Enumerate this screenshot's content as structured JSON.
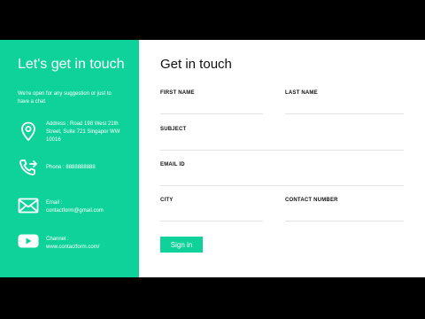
{
  "left": {
    "title": "Let's get in touch",
    "subtitle": "We're open for any suggestion or just to have a chat",
    "address": "Address : Road 198 West 21th Street, Suite 721 Singapor WW 10016",
    "phone": "Phone : 8888888888",
    "email_label": "Email :",
    "email_value": "contactform@gmail.com",
    "channel_label": "Channel :",
    "channel_value": "www.contactform.com/"
  },
  "form": {
    "title": "Get in touch",
    "first_name": "FIRST NAME",
    "last_name": "LAST NAME",
    "subject": "SUBJECT",
    "email_id": "EMAIL ID",
    "city": "CITY",
    "contact_number": "CONTACT NUMBER",
    "submit": "Sign in"
  },
  "colors": {
    "accent": "#0fd29a",
    "background": "#000000",
    "card": "#ffffff",
    "text": "#111111"
  },
  "icons": {
    "address": "map-pin-icon",
    "phone": "phone-forward-icon",
    "email": "envelope-icon",
    "channel": "youtube-play-icon"
  }
}
